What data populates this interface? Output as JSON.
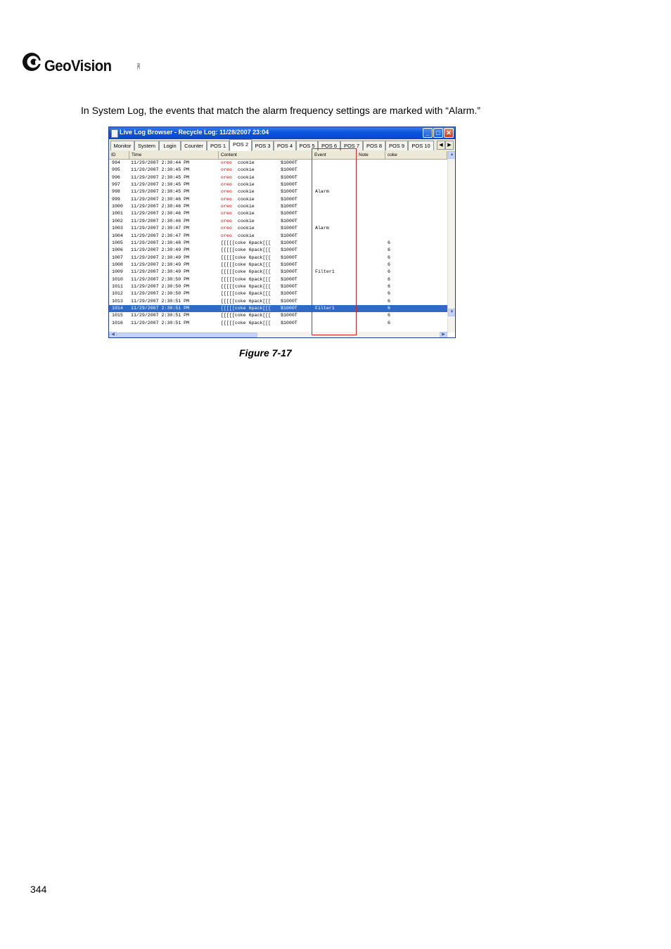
{
  "logo": {
    "text": "GeoVision",
    "tm": "INC."
  },
  "intro_text": "In System Log, the events that match the alarm frequency settings are marked with “Alarm.”",
  "window": {
    "title": "Live Log Browser  -  Recycle Log: 11/28/2007 23:04",
    "buttons": {
      "minimize": "_",
      "maximize": "□",
      "close": "✕"
    },
    "tabs": [
      "Monitor",
      "System",
      "Login",
      "Counter",
      "POS 1",
      "POS 2",
      "POS 3",
      "POS 4",
      "POS 5",
      "POS 6",
      "POS 7",
      "POS 8",
      "POS 9",
      "POS 10"
    ],
    "active_tab": "POS 2",
    "columns": [
      "ID",
      "Time",
      "Content",
      "Event",
      "Note",
      "coke"
    ],
    "rows": [
      {
        "id": "994",
        "time": "11/29/2007 2:30:44 PM",
        "c1": "oreo",
        "c2": "cookie",
        "c3": "$1000T",
        "event": "",
        "coke": ""
      },
      {
        "id": "995",
        "time": "11/29/2007 2:30:45 PM",
        "c1": "oreo",
        "c2": "cookie",
        "c3": "$1000T",
        "event": "",
        "coke": ""
      },
      {
        "id": "996",
        "time": "11/29/2007 2:30:45 PM",
        "c1": "oreo",
        "c2": "cookie",
        "c3": "$1000T",
        "event": "",
        "coke": ""
      },
      {
        "id": "997",
        "time": "11/29/2007 2:30:45 PM",
        "c1": "oreo",
        "c2": "cookie",
        "c3": "$1000T",
        "event": "",
        "coke": ""
      },
      {
        "id": "998",
        "time": "11/29/2007 2:30:45 PM",
        "c1": "oreo",
        "c2": "cookie",
        "c3": "$1000T",
        "event": "Alarm",
        "coke": ""
      },
      {
        "id": "999",
        "time": "11/29/2007 2:30:46 PM",
        "c1": "oreo",
        "c2": "cookie",
        "c3": "$1000T",
        "event": "",
        "coke": ""
      },
      {
        "id": "1000",
        "time": "11/29/2007 2:30:46 PM",
        "c1": "oreo",
        "c2": "cookie",
        "c3": "$1000T",
        "event": "",
        "coke": ""
      },
      {
        "id": "1001",
        "time": "11/29/2007 2:30:46 PM",
        "c1": "oreo",
        "c2": "cookie",
        "c3": "$1000T",
        "event": "",
        "coke": ""
      },
      {
        "id": "1002",
        "time": "11/29/2007 2:30:46 PM",
        "c1": "oreo",
        "c2": "cookie",
        "c3": "$1000T",
        "event": "",
        "coke": ""
      },
      {
        "id": "1003",
        "time": "11/29/2007 2:30:47 PM",
        "c1": "oreo",
        "c2": "cookie",
        "c3": "$1000T",
        "event": "Alarm",
        "coke": ""
      },
      {
        "id": "1004",
        "time": "11/29/2007 2:30:47 PM",
        "c1": "oreo",
        "c2": "cookie",
        "c3": "$1000T",
        "event": "",
        "coke": ""
      },
      {
        "id": "1005",
        "time": "11/29/2007 2:30:48 PM",
        "c1": "",
        "c2": "[[[[[coke 6pack[[[",
        "c3": "$1000T",
        "event": "",
        "coke": "6"
      },
      {
        "id": "1006",
        "time": "11/29/2007 2:30:49 PM",
        "c1": "",
        "c2": "[[[[[coke 6pack[[[",
        "c3": "$1000T",
        "event": "",
        "coke": "6"
      },
      {
        "id": "1007",
        "time": "11/29/2007 2:30:49 PM",
        "c1": "",
        "c2": "[[[[[coke 6pack[[[",
        "c3": "$1000T",
        "event": "",
        "coke": "6"
      },
      {
        "id": "1008",
        "time": "11/29/2007 2:30:49 PM",
        "c1": "",
        "c2": "[[[[[coke 6pack[[[",
        "c3": "$1000T",
        "event": "",
        "coke": "6"
      },
      {
        "id": "1009",
        "time": "11/29/2007 2:30:49 PM",
        "c1": "",
        "c2": "[[[[[coke 6pack[[[",
        "c3": "$1000T",
        "event": "Filter1",
        "coke": "6"
      },
      {
        "id": "1010",
        "time": "11/29/2007 2:30:50 PM",
        "c1": "",
        "c2": "[[[[[coke 6pack[[[",
        "c3": "$1000T",
        "event": "",
        "coke": "6"
      },
      {
        "id": "1011",
        "time": "11/29/2007 2:30:50 PM",
        "c1": "",
        "c2": "[[[[[coke 6pack[[[",
        "c3": "$1000T",
        "event": "",
        "coke": "6"
      },
      {
        "id": "1012",
        "time": "11/29/2007 2:30:50 PM",
        "c1": "",
        "c2": "[[[[[coke 6pack[[[",
        "c3": "$1000T",
        "event": "",
        "coke": "6"
      },
      {
        "id": "1013",
        "time": "11/29/2007 2:30:51 PM",
        "c1": "",
        "c2": "[[[[[coke 6pack[[[",
        "c3": "$1000T",
        "event": "",
        "coke": "6"
      },
      {
        "id": "1014",
        "time": "11/29/2007 2:30:51 PM",
        "c1": "",
        "c2": "[[[[[coke 6pack[[[",
        "c3": "$1000T",
        "event": "Filter1",
        "coke": "6",
        "selected": true
      },
      {
        "id": "1015",
        "time": "11/29/2007 2:30:51 PM",
        "c1": "",
        "c2": "[[[[[coke 6pack[[[",
        "c3": "$1000T",
        "event": "",
        "coke": "6"
      },
      {
        "id": "1016",
        "time": "11/29/2007 2:30:51 PM",
        "c1": "",
        "c2": "[[[[[coke 6pack[[[",
        "c3": "$1000T",
        "event": "",
        "coke": "6"
      }
    ]
  },
  "caption": "Figure 7-17",
  "page_number": "344",
  "colors": {
    "title_bar": "#0a55df",
    "selection": "#316ac5",
    "highlight_box": "#e02020",
    "content_red": "#d00000"
  }
}
